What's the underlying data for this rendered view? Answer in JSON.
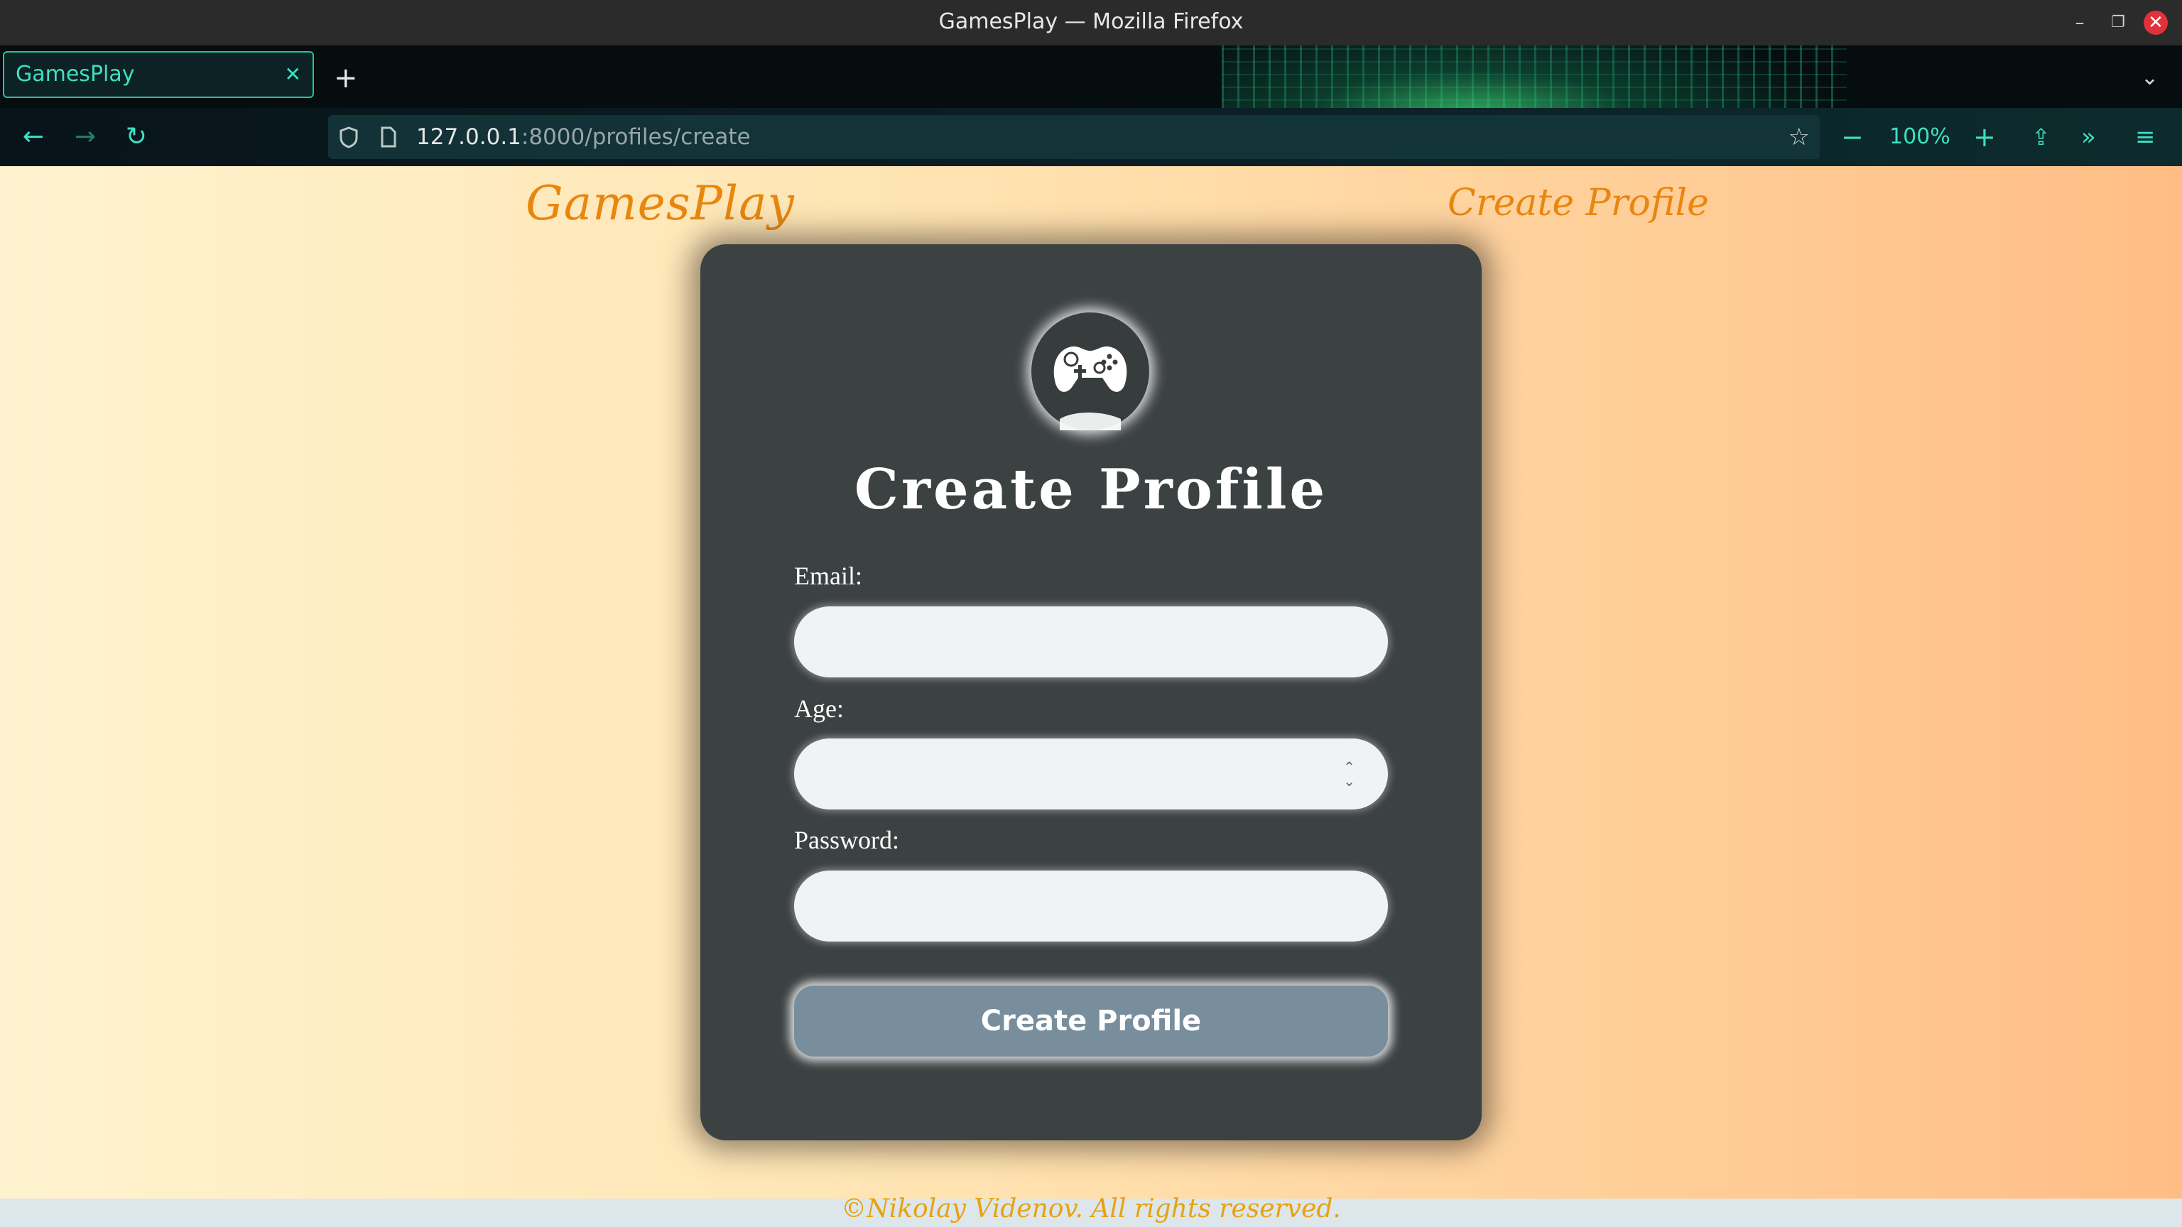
{
  "window": {
    "title": "GamesPlay — Mozilla Firefox",
    "minimize_icon": "–",
    "maximize_icon": "❐",
    "close_icon": "✕"
  },
  "tabs": [
    {
      "label": "GamesPlay",
      "close": "✕",
      "active": true
    }
  ],
  "tabstrip": {
    "new_tab": "+",
    "list_all": "⌄"
  },
  "toolbar": {
    "back": "←",
    "forward": "→",
    "reload": "↻",
    "url_host": "127.0.0.1",
    "url_rest": ":8000/profiles/create",
    "bookmark": "☆",
    "zoom_out": "−",
    "zoom_level": "100%",
    "zoom_in": "+",
    "extensions": "⇪",
    "overflow": "»",
    "menu": "≡"
  },
  "page": {
    "logo": "GamesPlay",
    "nav_link": "Create Profile",
    "form": {
      "title": "Create Profile",
      "fields": [
        {
          "label": "Email:",
          "value": "",
          "type": "email"
        },
        {
          "label": "Age:",
          "value": "",
          "type": "number"
        },
        {
          "label": "Password:",
          "value": "",
          "type": "password"
        }
      ],
      "spinner": "⌃⌄",
      "submit": "Create Profile"
    },
    "footer": "©Nikolay Videnov. All rights reserved."
  },
  "colors": {
    "accent": "#e8860e",
    "card": "#3c4142",
    "button": "#798e9c",
    "browser_accent": "#3de0c2"
  }
}
